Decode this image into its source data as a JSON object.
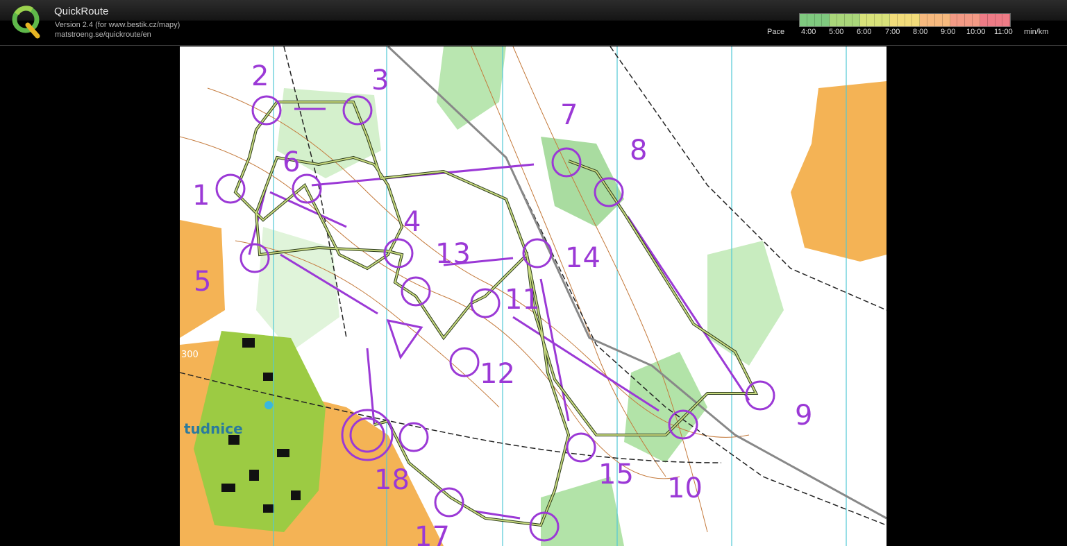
{
  "app": {
    "title": "QuickRoute",
    "version": "Version 2.4  (for www.bestik.cz/mapy)",
    "url": "matstroeng.se/quickroute/en"
  },
  "pace_legend": {
    "label": "Pace",
    "ticks": [
      "4:00",
      "5:00",
      "6:00",
      "7:00",
      "8:00",
      "9:00",
      "10:00",
      "11:00"
    ],
    "unit": "min/km",
    "colors": [
      "#7fc97f",
      "#a9d67a",
      "#d8e27a",
      "#f2dc7a",
      "#f6b97e",
      "#f39a85",
      "#ee7b86"
    ]
  },
  "map": {
    "place_label": "tudnice",
    "contour_label": "300",
    "controls": [
      "1",
      "2",
      "3",
      "4",
      "5",
      "6",
      "7",
      "8",
      "9",
      "10",
      "11",
      "12",
      "13",
      "14",
      "15",
      "17",
      "18"
    ]
  }
}
